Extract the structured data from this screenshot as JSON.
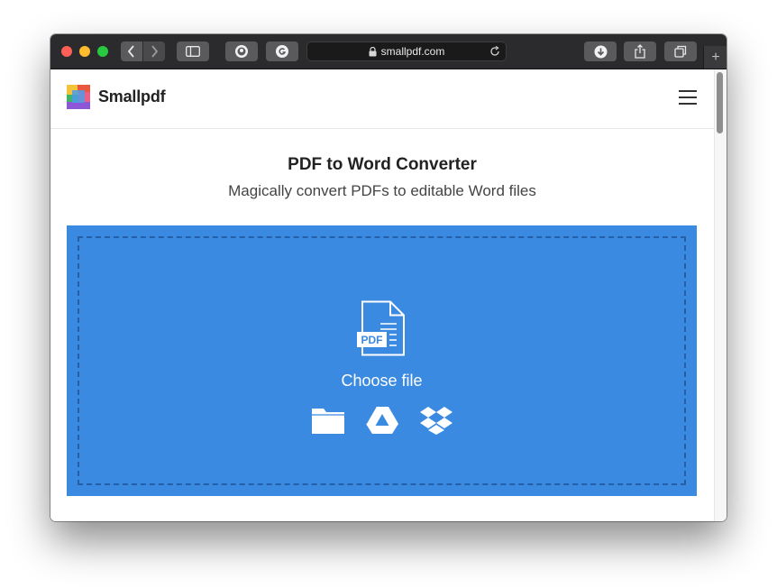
{
  "browser": {
    "url": "smallpdf.com",
    "new_tab_symbol": "+"
  },
  "site": {
    "brand": "Smallpdf"
  },
  "main": {
    "title": "PDF to Word Converter",
    "subtitle": "Magically convert PDFs to editable Word files",
    "dropzone": {
      "file_badge": "PDF",
      "choose_label": "Choose file",
      "sources": [
        "folder-icon",
        "google-drive-icon",
        "dropbox-icon"
      ]
    }
  },
  "colors": {
    "accent": "#3b8ae2",
    "titlebar": "#2b2b2d"
  }
}
